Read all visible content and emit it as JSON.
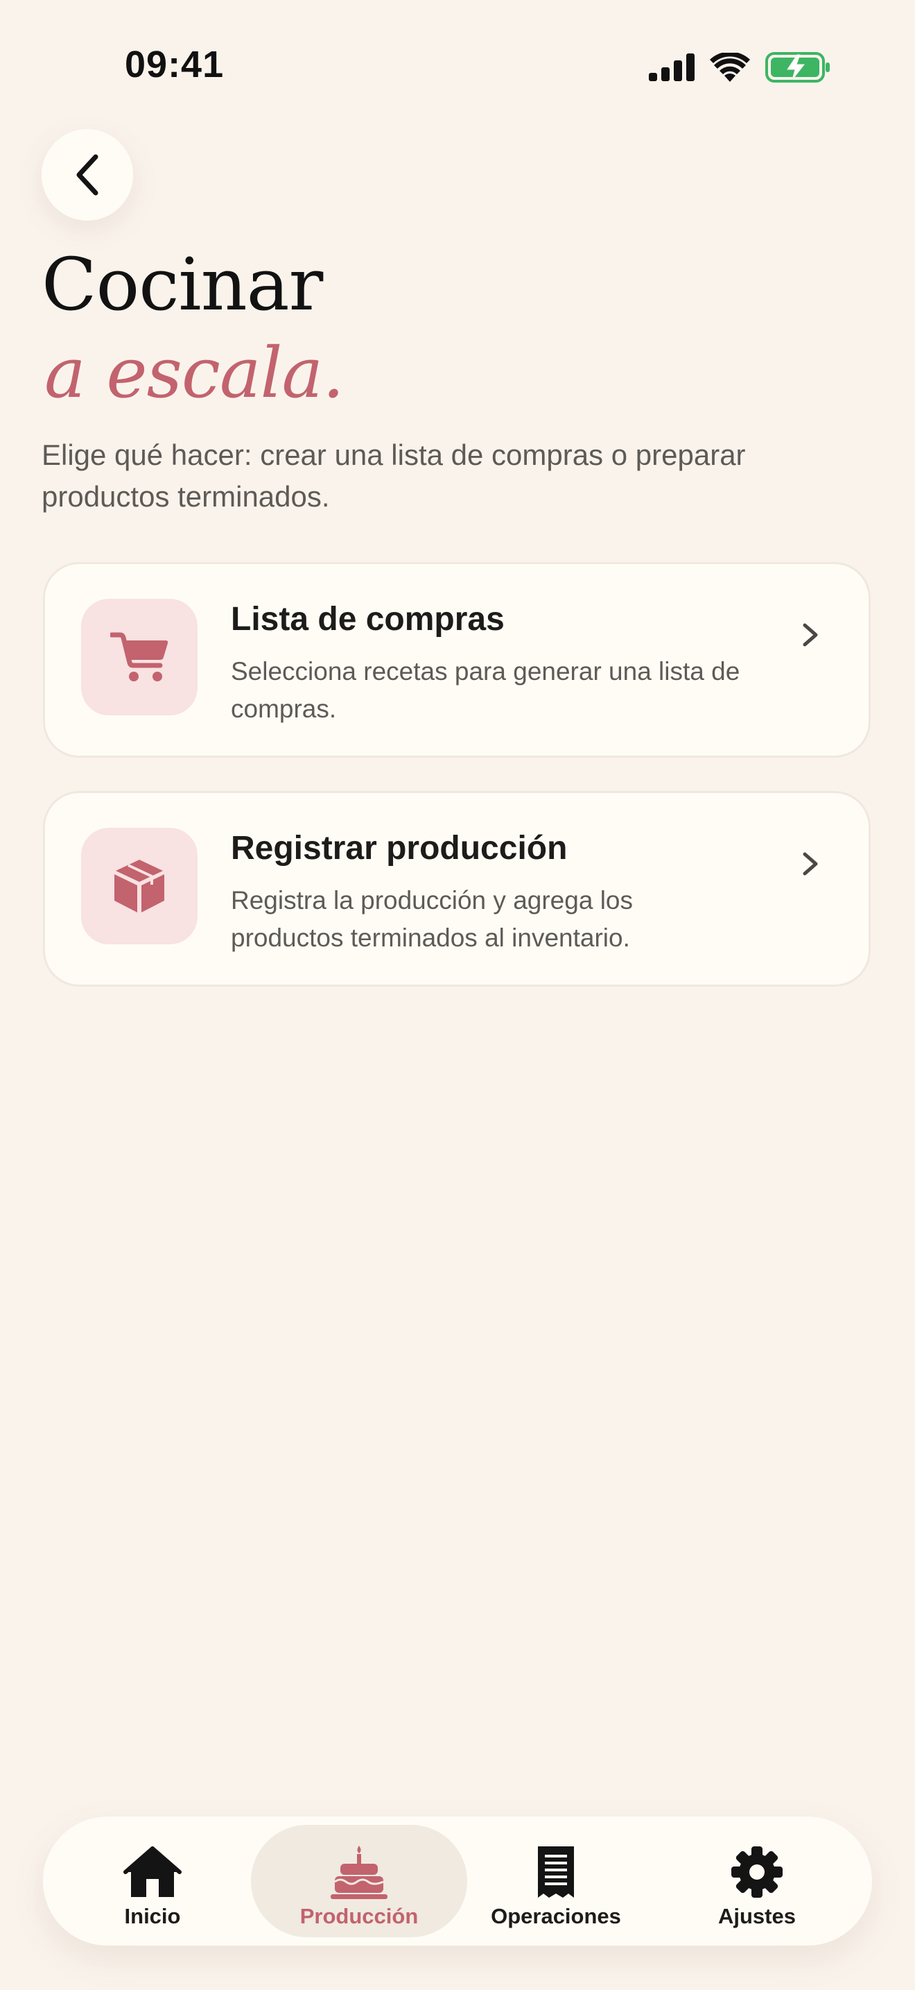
{
  "status_bar": {
    "time": "09:41"
  },
  "header": {
    "back_icon": "chevron-left-icon",
    "title": "Cocinar",
    "title_accent": "a escala.",
    "subtitle": "Elige qué hacer: crear una lista de compras o preparar productos terminados."
  },
  "options": [
    {
      "icon": "shopping-cart-icon",
      "title": "Lista de compras",
      "description": "Selecciona recetas para generar una lista de compras."
    },
    {
      "icon": "box-icon",
      "title": "Registrar producción",
      "description": "Registra la producción y agrega los productos terminados al inventario."
    }
  ],
  "tab_bar": {
    "active_index": 1,
    "tabs": [
      {
        "label": "Inicio",
        "icon": "home-icon"
      },
      {
        "label": "Producción",
        "icon": "cake-icon"
      },
      {
        "label": "Operaciones",
        "icon": "receipt-icon"
      },
      {
        "label": "Ajustes",
        "icon": "gear-icon"
      }
    ]
  },
  "colors": {
    "background": "#FAF3EC",
    "card": "#FFFCF6",
    "accent": "#C2636E",
    "icon_tile": "#F8E2E2",
    "battery": "#3DB563"
  }
}
